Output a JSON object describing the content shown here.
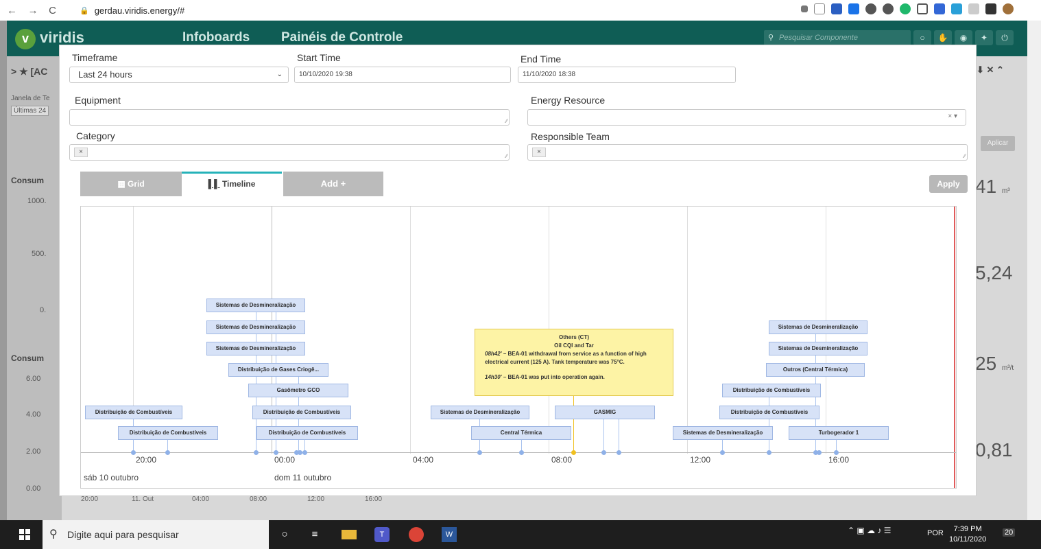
{
  "browser": {
    "back": "←",
    "forward": "→",
    "reload": "C",
    "url": "gerdau.viridis.energy/#"
  },
  "app": {
    "logo_letter": "v",
    "logo_text": "viridis",
    "crumb_infoboards": "Infoboards",
    "crumb_paineis": "Painéis de Controle",
    "search_placeholder": "Pesquisar Componente",
    "left_bar_label": "[AC",
    "janela_label": "Janela de Te",
    "janela_value": "Últimas 24",
    "consumo1": "Consum",
    "consumo2": "Consum",
    "y1000": "1000.",
    "y500": "500.",
    "y0": "0.",
    "y600": "6.00",
    "y400": "4.00",
    "y200": "2.00",
    "y000": "0.00",
    "right_val1": "41",
    "right_unit1": "m³",
    "right_val2": "5,24",
    "right_val3": "25",
    "right_unit3": "m³/t",
    "right_val4": "0,81",
    "aplicar": "Aplicar",
    "bottom_ticks": [
      "20:00",
      "11. Out",
      "04:00",
      "08:00",
      "12:00",
      "16:00"
    ]
  },
  "filters": {
    "timeframe_label": "Timeframe",
    "timeframe_value": "Last 24 hours",
    "start_label": "Start Time",
    "start_value": "10/10/2020 19:38",
    "end_label": "End Time",
    "end_value": "11/10/2020 18:38",
    "equipment_label": "Equipment",
    "energy_label": "Energy Resource",
    "category_label": "Category",
    "team_label": "Responsible Team",
    "chip": "×",
    "clear": "× ▾"
  },
  "tabs": {
    "grid": "Grid",
    "timeline": "Timeline",
    "add": "Add +",
    "apply": "Apply"
  },
  "timeline": {
    "ticks": [
      "20:00",
      "00:00",
      "04:00",
      "08:00",
      "12:00",
      "16:00"
    ],
    "day1": "sáb 10 outubro",
    "day2": "dom 11 outubro",
    "events": [
      "Distribuição de Combustíveis",
      "Distribuição de Combustíveis",
      "Sistemas de Desmineralização",
      "Sistemas de Desmineralização",
      "Sistemas de Desmineralização",
      "Distribuição de Gases Criogê...",
      "Gasômetro GCO",
      "Distribuição de Combustíveis",
      "Distribuição de Combustíveis",
      "Sistemas de Desmineralização",
      "Central Térmica",
      "GASMIG",
      "Sistemas de Desmineralização",
      "Sistemas de Desmineralização",
      "Outros (Central Térmica)",
      "Distribuição de Combustíveis",
      "Distribuição de Combustíveis",
      "Sistemas de Desmineralização",
      "Turbogerador 1"
    ],
    "tooltip": {
      "title": "Others (CT)",
      "subtitle": "Oil CQI and Tar",
      "line1_time": "08h42'",
      "line1_text": " – BEA-01 withdrawal from service as a function of high electrical current (125 A). Tank temperature was 75°C.",
      "line2_time": "14h30'",
      "line2_text": " – BEA-01 was put into operation again."
    }
  },
  "taskbar": {
    "search_placeholder": "Digite aqui para pesquisar",
    "lang": "POR",
    "time": "7:39 PM",
    "date": "10/11/2020",
    "notif": "20"
  }
}
